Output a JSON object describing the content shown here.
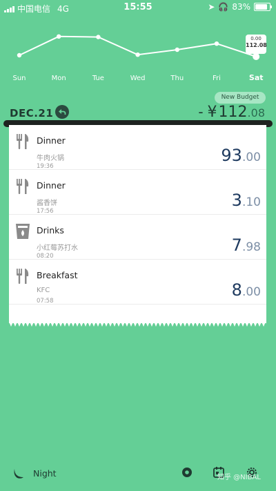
{
  "status": {
    "carrier": "中国电信",
    "network": "4G",
    "time": "15:55",
    "battery": "83%",
    "battery_level": 0.83
  },
  "chart_data": {
    "type": "line",
    "categories": [
      "Sun",
      "Mon",
      "Tue",
      "Wed",
      "Thu",
      "Fri",
      "Sat"
    ],
    "values": [
      0.3,
      0.98,
      0.96,
      0.32,
      0.5,
      0.72,
      0.25
    ],
    "active_index": 6,
    "color": "#ffffff"
  },
  "tooltip": {
    "line1": "0.00",
    "line2": "112.08"
  },
  "header": {
    "new_budget": "New Budget",
    "date": "DEC.21",
    "total_sign": "-",
    "currency": "¥",
    "total_int": "112",
    "total_dec": ".08"
  },
  "items": [
    {
      "title": "Dinner",
      "sub": "牛肉火锅",
      "time": "19:36",
      "amount_int": "93",
      "amount_dec": ".00",
      "icon": "fork-knife-icon"
    },
    {
      "title": "Dinner",
      "sub": "酱香饼",
      "time": "17:56",
      "amount_int": "3",
      "amount_dec": ".10",
      "icon": "fork-knife-icon"
    },
    {
      "title": "Drinks",
      "sub": "小红莓苏打水",
      "time": "08:20",
      "amount_int": "7",
      "amount_dec": ".98",
      "icon": "drink-cup-icon"
    },
    {
      "title": "Breakfast",
      "sub": "KFC",
      "time": "07:58",
      "amount_int": "8",
      "amount_dec": ".00",
      "icon": "fork-knife-icon"
    }
  ],
  "bottom": {
    "night_label": "Night",
    "watermark": "知乎 @NIBAL"
  },
  "colors": {
    "background": "#64cf96",
    "dark": "#1f3a31",
    "amount": "#1e3a5f"
  }
}
